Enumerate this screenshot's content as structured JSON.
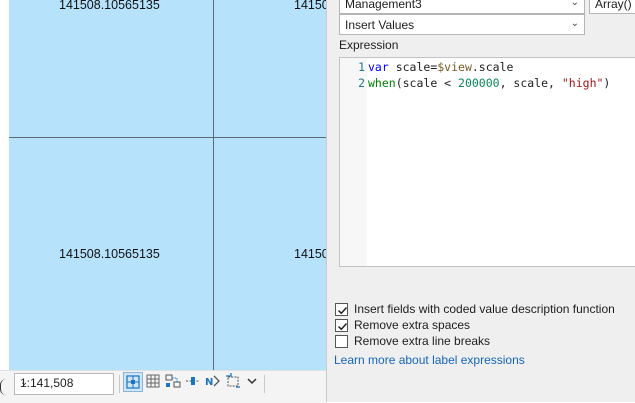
{
  "map": {
    "labels": [
      "141508.10565135",
      "14150",
      "141508.10565135",
      "14150"
    ]
  },
  "statusbar": {
    "scale_value": "1:141,508",
    "tool_icons": [
      "grid-snap-icon",
      "grid-icon",
      "measure-icon",
      "fixed-extent-icon",
      "navigation-icon",
      "rotate-icon",
      "chevron-down-icon"
    ]
  },
  "panel": {
    "top_combo_1": "Management3",
    "top_combo_2": "Array()",
    "insert_combo": "Insert Values",
    "expression_label": "Expression",
    "code_line_numbers": [
      "1",
      "2"
    ],
    "code": {
      "l1_kw": "var",
      "l1_rest": " scale=",
      "l1_var": "$view",
      "l1_end": ".scale",
      "l2_fn": "when",
      "l2_a": "(scale < ",
      "l2_num": "200000",
      "l2_b": ", scale, ",
      "l2_str": "\"high\"",
      "l2_c": ")"
    },
    "options": [
      {
        "label": "Insert fields with coded value description function",
        "checked": true
      },
      {
        "label": "Remove extra spaces",
        "checked": true
      },
      {
        "label": "Remove extra line breaks",
        "checked": false
      }
    ],
    "learn_link": "Learn more about label expressions"
  }
}
